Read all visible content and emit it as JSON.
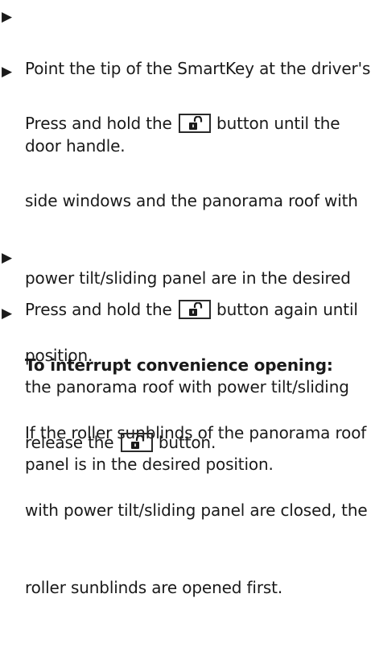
{
  "steps": [
    {
      "lines": [
        "Point the tip of the SmartKey at the driver's",
        "door handle."
      ]
    },
    {
      "before_button": "Press and hold the ",
      "after_button": " button until the",
      "lines": [
        "side windows and the panorama roof with",
        "power tilt/sliding panel are in the desired",
        "position.",
        "If the roller sunblinds of the panorama roof",
        "with power tilt/sliding panel are closed, the",
        "roller sunblinds are opened first."
      ]
    },
    {
      "before_button": "Press and hold the ",
      "after_button": " button again until",
      "lines": [
        "the panorama roof with power tilt/sliding",
        "panel is in the desired position."
      ]
    },
    {
      "heading": "To interrupt convenience opening:",
      "before_button": "release the ",
      "after_button": " button."
    }
  ],
  "bullet_glyph": "▶",
  "icons": {
    "unlock_button": "unlock-padlock-icon"
  }
}
